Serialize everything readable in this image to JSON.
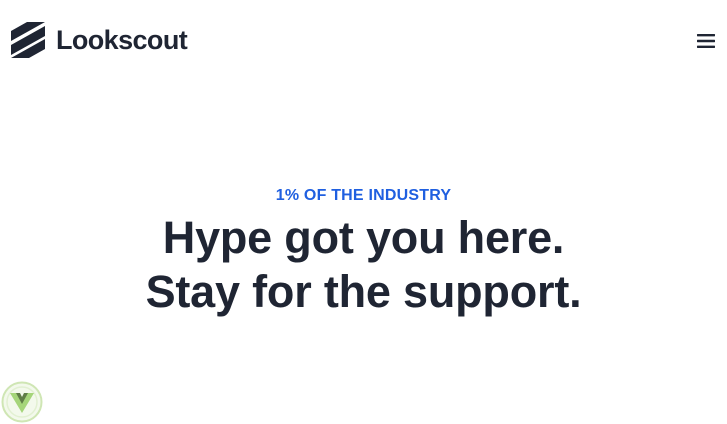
{
  "header": {
    "brand_name": "Lookscout",
    "logo_icon": "lookscout-logo-icon",
    "menu_icon": "hamburger-menu-icon"
  },
  "hero": {
    "eyebrow": "1% OF THE INDUSTRY",
    "headline_line1": "Hype got you here.",
    "headline_line2": "Stay for the support."
  },
  "badge": {
    "icon": "vuejs-badge-icon"
  },
  "colors": {
    "text_dark": "#1f2533",
    "accent_blue": "#1f5fe0",
    "badge_green": "#8bc34a",
    "background": "#ffffff"
  }
}
